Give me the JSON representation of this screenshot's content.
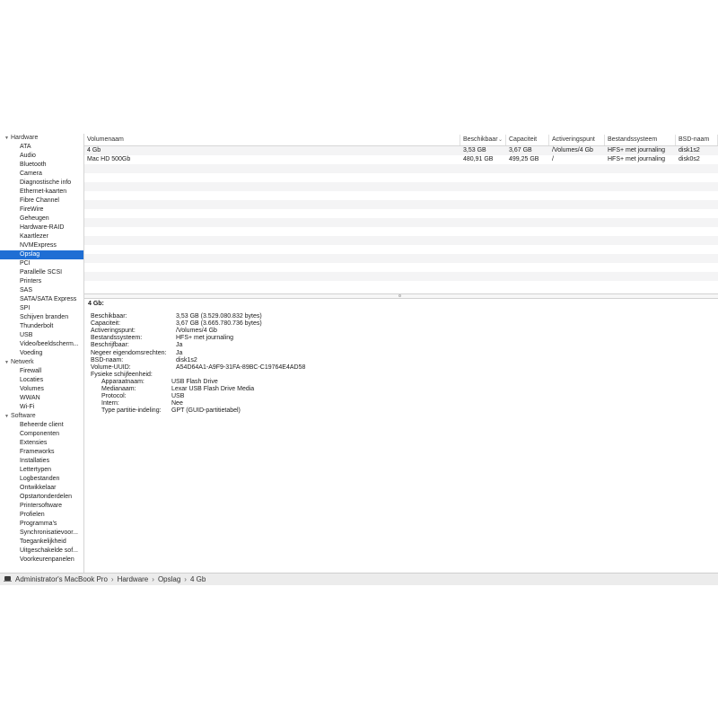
{
  "sidebar": [
    {
      "type": "group",
      "label": "Hardware"
    },
    {
      "type": "item",
      "label": "ATA"
    },
    {
      "type": "item",
      "label": "Audio"
    },
    {
      "type": "item",
      "label": "Bluetooth"
    },
    {
      "type": "item",
      "label": "Camera"
    },
    {
      "type": "item",
      "label": "Diagnostische info"
    },
    {
      "type": "item",
      "label": "Ethernet-kaarten"
    },
    {
      "type": "item",
      "label": "Fibre Channel"
    },
    {
      "type": "item",
      "label": "FireWire"
    },
    {
      "type": "item",
      "label": "Geheugen"
    },
    {
      "type": "item",
      "label": "Hardware-RAID"
    },
    {
      "type": "item",
      "label": "Kaartlezer"
    },
    {
      "type": "item",
      "label": "NVMExpress"
    },
    {
      "type": "item",
      "label": "Opslag",
      "selected": true
    },
    {
      "type": "item",
      "label": "PCI"
    },
    {
      "type": "item",
      "label": "Parallelle SCSI"
    },
    {
      "type": "item",
      "label": "Printers"
    },
    {
      "type": "item",
      "label": "SAS"
    },
    {
      "type": "item",
      "label": "SATA/SATA Express"
    },
    {
      "type": "item",
      "label": "SPI"
    },
    {
      "type": "item",
      "label": "Schijven branden"
    },
    {
      "type": "item",
      "label": "Thunderbolt"
    },
    {
      "type": "item",
      "label": "USB"
    },
    {
      "type": "item",
      "label": "Video/beeldscherm..."
    },
    {
      "type": "item",
      "label": "Voeding"
    },
    {
      "type": "group",
      "label": "Netwerk"
    },
    {
      "type": "item",
      "label": "Firewall"
    },
    {
      "type": "item",
      "label": "Locaties"
    },
    {
      "type": "item",
      "label": "Volumes"
    },
    {
      "type": "item",
      "label": "WWAN"
    },
    {
      "type": "item",
      "label": "Wi-Fi"
    },
    {
      "type": "group",
      "label": "Software"
    },
    {
      "type": "item",
      "label": "Beheerde client"
    },
    {
      "type": "item",
      "label": "Componenten"
    },
    {
      "type": "item",
      "label": "Extensies"
    },
    {
      "type": "item",
      "label": "Frameworks"
    },
    {
      "type": "item",
      "label": "Installaties"
    },
    {
      "type": "item",
      "label": "Lettertypen"
    },
    {
      "type": "item",
      "label": "Logbestanden"
    },
    {
      "type": "item",
      "label": "Ontwikkelaar"
    },
    {
      "type": "item",
      "label": "Opstartonderdelen"
    },
    {
      "type": "item",
      "label": "Printersoftware"
    },
    {
      "type": "item",
      "label": "Profielen"
    },
    {
      "type": "item",
      "label": "Programma's"
    },
    {
      "type": "item",
      "label": "Synchronisatievoor..."
    },
    {
      "type": "item",
      "label": "Toegankelijkheid"
    },
    {
      "type": "item",
      "label": "Uitgeschakelde sof..."
    },
    {
      "type": "item",
      "label": "Voorkeurenpanelen"
    }
  ],
  "table": {
    "columns": [
      "Volumenaam",
      "Beschikbaar",
      "Capaciteit",
      "Activeringspunt",
      "Bestandssysteem",
      "BSD-naam"
    ],
    "rows": [
      [
        "4 Gb",
        "3,53 GB",
        "3,67 GB",
        "/Volumes/4 Gb",
        "HFS+ met journaling",
        "disk1s2"
      ],
      [
        "Mac HD 500Gb",
        "480,91 GB",
        "499,25 GB",
        "/",
        "HFS+ met journaling",
        "disk0s2"
      ]
    ],
    "empty_rows": 14
  },
  "detail": {
    "title": "4 Gb:",
    "fields": [
      {
        "label": "Beschikbaar:",
        "value": "3,53 GB (3.529.080.832 bytes)",
        "level": 0
      },
      {
        "label": "Capaciteit:",
        "value": "3,67 GB (3.665.780.736 bytes)",
        "level": 0
      },
      {
        "label": "Activeringspunt:",
        "value": "/Volumes/4 Gb",
        "level": 0
      },
      {
        "label": "Bestandssysteem:",
        "value": "HFS+ met journaling",
        "level": 0
      },
      {
        "label": "Beschrijfbaar:",
        "value": "Ja",
        "level": 0
      },
      {
        "label": "Negeer eigendomsrechten:",
        "value": "Ja",
        "level": 0
      },
      {
        "label": "BSD-naam:",
        "value": "disk1s2",
        "level": 0
      },
      {
        "label": "Volume-UUID:",
        "value": "A54D64A1-A9F9-31FA-89BC-C19764E4AD58",
        "level": 0
      },
      {
        "label": "Fysieke schijfeenheid:",
        "value": "",
        "level": 0
      },
      {
        "label": "Apparaatnaam:",
        "value": "USB Flash Drive",
        "level": 1
      },
      {
        "label": "Medianaam:",
        "value": "Lexar USB Flash Drive Media",
        "level": 1
      },
      {
        "label": "Protocol:",
        "value": "USB",
        "level": 1
      },
      {
        "label": "Intern:",
        "value": "Nee",
        "level": 1
      },
      {
        "label": "Type partitie-indeling:",
        "value": "GPT (GUID-partitietabel)",
        "level": 1
      }
    ]
  },
  "statusbar": {
    "icon": "laptop-icon",
    "breadcrumbs": [
      "Administrator's MacBook Pro",
      "Hardware",
      "Opslag",
      "4 Gb"
    ],
    "separator": "›"
  },
  "colors": {
    "selection": "#1f6ed4",
    "stripe": "#f4f4f5"
  }
}
